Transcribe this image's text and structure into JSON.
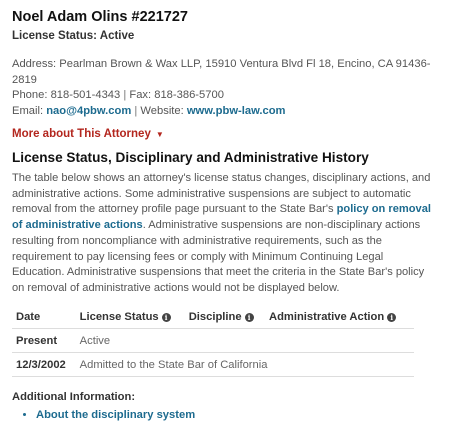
{
  "attorney": {
    "name": "Noel Adam Olins #221727",
    "license_status": "License Status: Active",
    "address": "Address: Pearlman Brown & Wax LLP, 15910 Ventura Blvd Fl 18, Encino, CA 91436-2819",
    "phone": "Phone: 818-501-4343",
    "fax": "Fax: 818-386-5700",
    "email_label": "Email:",
    "email": "nao@4pbw.com",
    "website_label": "Website:",
    "website": "www.pbw-law.com",
    "separator": "|"
  },
  "more_about": {
    "label": "More about This Attorney",
    "icon": "caret-down-icon",
    "color": "#b3261e"
  },
  "history": {
    "title": "License Status, Disciplinary and Administrative History",
    "para_part1": "The table below shows an attorney's license status changes, disciplinary actions, and administrative actions. Some administrative suspensions are subject to automatic removal from the attorney profile page pursuant to the State Bar's ",
    "para_link": "policy on removal of administrative actions",
    "para_part2": ". Administrative suspensions are non-disciplinary actions resulting from noncompliance with administrative requirements, such as the requirement to pay licensing fees or comply with Minimum Continuing Legal Education. Administrative suspensions that meet the criteria in the State Bar's policy on removal of administrative actions would not be displayed below.",
    "columns": [
      "Date",
      "License Status",
      "Discipline",
      "Administrative Action"
    ],
    "rows": [
      {
        "date": "Present",
        "status": "Active"
      },
      {
        "date": "12/3/2002",
        "status": "Admitted to the State Bar of California"
      }
    ],
    "info_icon": "info-circle-icon"
  },
  "additional": {
    "label": "Additional Information:",
    "links": [
      "About the disciplinary system"
    ]
  },
  "colors": {
    "link": "#1d6b8f",
    "text": "#555555",
    "heading": "#111111"
  }
}
